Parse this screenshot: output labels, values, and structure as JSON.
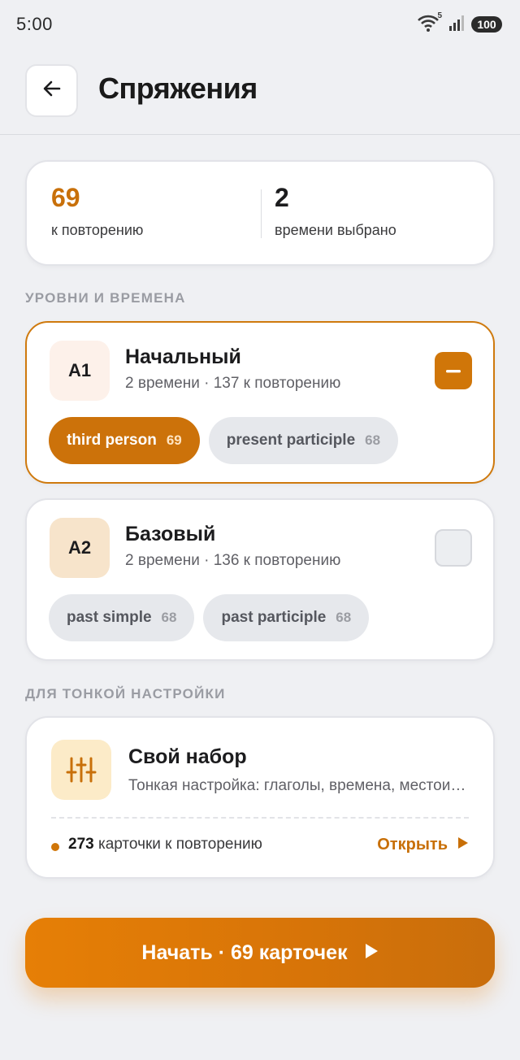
{
  "status_bar": {
    "time": "5:00",
    "wifi_badge": "5",
    "battery": "100"
  },
  "header": {
    "title": "Спряжения",
    "back_icon": "arrow-left-icon"
  },
  "stats": {
    "due": {
      "value": "69",
      "label": "к повторению",
      "color": "#c8700a"
    },
    "selected": {
      "value": "2",
      "label": "времени выбрано"
    }
  },
  "sections": {
    "levels": "УРОВНИ И ВРЕМЕНА",
    "fine_tune": "ДЛЯ ТОНКОЙ НАСТРОЙКИ"
  },
  "levels": [
    {
      "code": "A1",
      "name": "Начальный",
      "meta": "2 времени · 137 к повторению",
      "selected": true,
      "badge_color": "#fdf1ea",
      "chips": [
        {
          "label": "third person",
          "count": "69",
          "selected": true
        },
        {
          "label": "present participle",
          "count": "68",
          "selected": false
        }
      ]
    },
    {
      "code": "A2",
      "name": "Базовый",
      "meta": "2 времени · 136 к повторению",
      "selected": false,
      "badge_color": "#f7e4cb",
      "chips": [
        {
          "label": "past simple",
          "count": "68",
          "selected": false
        },
        {
          "label": "past participle",
          "count": "68",
          "selected": false
        }
      ]
    }
  ],
  "custom": {
    "title": "Свой набор",
    "subtitle": "Тонкая настройка: глаголы, времена, местоимения",
    "count": "273",
    "count_label": " карточки к повторению",
    "open_label": "Открыть",
    "icon": "sliders-icon"
  },
  "start_button": {
    "label": "Начать · 69 карточек",
    "icon": "play-icon"
  },
  "colors": {
    "accent": "#d07609",
    "background": "#eff0f3"
  }
}
